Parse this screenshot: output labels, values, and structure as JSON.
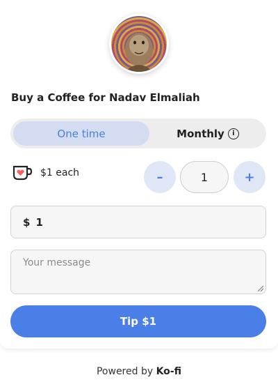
{
  "header": {
    "title": "Buy a Coffee for Nadav Elmaliah"
  },
  "frequency": {
    "active_label": "One time",
    "other_label": "Monthly",
    "info_icon": "info-icon",
    "info_glyph": "i"
  },
  "item": {
    "icon": "coffee-cup-heart-icon",
    "price_label": "$1 each"
  },
  "quantity": {
    "minus_label": "–",
    "value": "1",
    "plus_label": "+"
  },
  "amount": {
    "currency": "$",
    "value": "1"
  },
  "message": {
    "placeholder": "Your message"
  },
  "tip_button": {
    "label": "Tip $1"
  },
  "footer": {
    "prefix": "Powered by ",
    "brand": "Ko-fi"
  },
  "colors": {
    "accent": "#4a7fe8",
    "active_bg": "#d3dcf0",
    "cup_red": "#ff5e5b"
  }
}
